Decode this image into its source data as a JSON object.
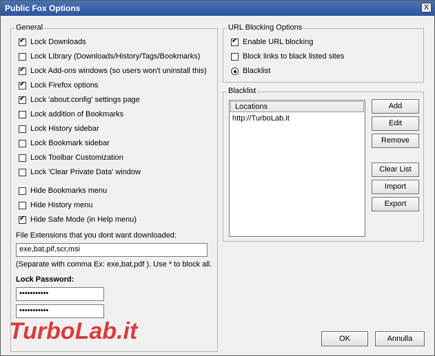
{
  "window": {
    "title": "Public Fox Options",
    "close_glyph": "X"
  },
  "general": {
    "legend": "General",
    "options": [
      {
        "label": "Lock Downloads",
        "checked": true
      },
      {
        "label": "Lock Library (Downloads/History/Tags/Bookmarks)",
        "checked": false
      },
      {
        "label": "Lock Add-ons windows (so users won't uninstall this)",
        "checked": true
      },
      {
        "label": "Lock Firefox options",
        "checked": true
      },
      {
        "label": "Lock 'about:config' settings page",
        "checked": true
      },
      {
        "label": "Lock addition of Bookmarks",
        "checked": false
      },
      {
        "label": "Lock History sidebar",
        "checked": false
      },
      {
        "label": "Lock Bookmark sidebar",
        "checked": false
      },
      {
        "label": "Lock Toolbar Customization",
        "checked": false
      },
      {
        "label": "Lock 'Clear Private Data' window",
        "checked": false
      }
    ],
    "hide_options": [
      {
        "label": "Hide Bookmarks menu",
        "checked": false
      },
      {
        "label": "Hide History menu",
        "checked": false
      },
      {
        "label": "Hide Safe Mode (in Help menu)",
        "checked": true
      }
    ],
    "extensions_label": "File Extensions that you dont want downloaded:",
    "extensions_value": "exe,bat,pif,scr,msi",
    "extensions_hint": "(Separate with comma Ex: exe,bat,pdf ). Use * to block all.",
    "password_label": "Lock Password:",
    "password_value": "•••••••••••",
    "password_confirm_value": "•••••••••••"
  },
  "url_blocking": {
    "legend": "URL Blocking Options",
    "enable_label": "Enable URL blocking",
    "enable_checked": true,
    "blacklisted_label": "Block links to black listed sites",
    "blacklisted_checked": false,
    "blacklist_radio_label": "Blacklist",
    "blacklist_radio_on": true
  },
  "blacklist": {
    "legend": "Blacklist",
    "column_header": "Locations",
    "items": [
      "http://TurboLab.it"
    ],
    "buttons": {
      "add": "Add",
      "edit": "Edit",
      "remove": "Remove",
      "clear": "Clear List",
      "import": "Import",
      "export": "Export"
    }
  },
  "footer": {
    "ok": "OK",
    "cancel": "Annulla"
  },
  "watermark": {
    "text": "TurboLab.it",
    "color": "#d32020"
  }
}
